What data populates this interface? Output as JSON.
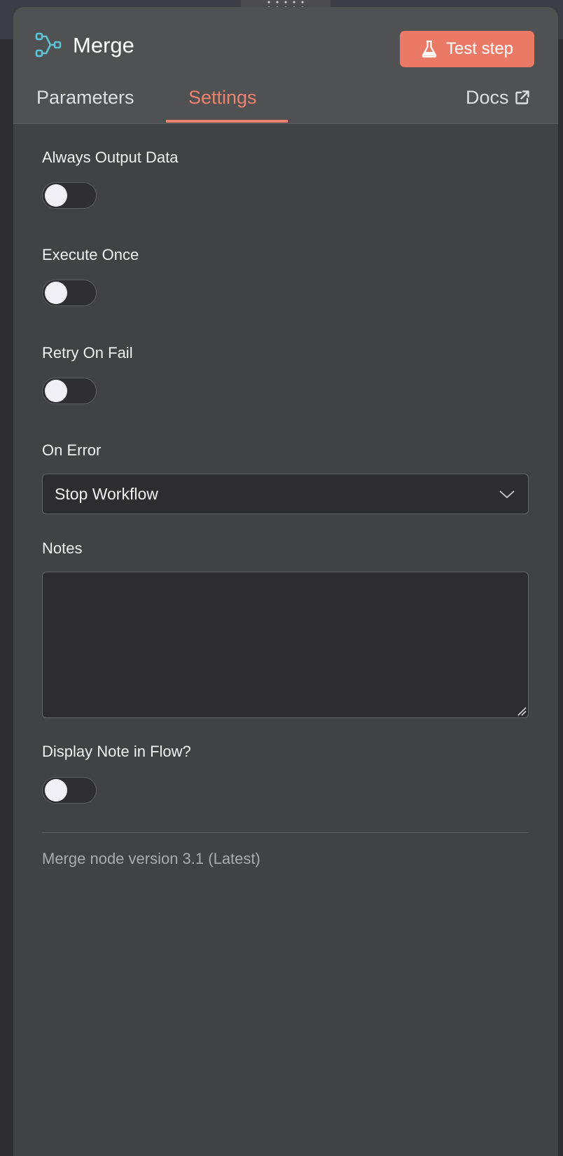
{
  "node": {
    "title": "Merge",
    "icon": "merge-icon",
    "accent_color": "#ea7a66",
    "icon_color": "#5ec3d6"
  },
  "header": {
    "test_button_label": "Test step",
    "test_button_icon": "flask-icon"
  },
  "tabs": [
    {
      "label": "Parameters",
      "active": false
    },
    {
      "label": "Settings",
      "active": true
    }
  ],
  "docs": {
    "label": "Docs",
    "icon": "external-link-icon"
  },
  "settings": {
    "always_output_data": {
      "label": "Always Output Data",
      "enabled": false
    },
    "execute_once": {
      "label": "Execute Once",
      "enabled": false
    },
    "retry_on_fail": {
      "label": "Retry On Fail",
      "enabled": false
    },
    "on_error": {
      "label": "On Error",
      "value": "Stop Workflow"
    },
    "notes": {
      "label": "Notes",
      "value": ""
    },
    "display_note_in_flow": {
      "label": "Display Note in Flow?",
      "enabled": false
    }
  },
  "footer": {
    "version_text": "Merge node version 3.1 (Latest)"
  }
}
